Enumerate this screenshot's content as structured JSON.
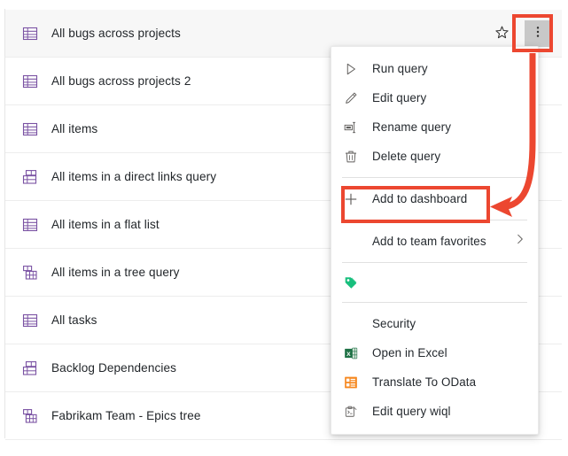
{
  "query_list": {
    "name": "shared-queries-list",
    "rows": [
      {
        "label": "All bugs across projects",
        "icon": "flat-query-icon",
        "selected": true
      },
      {
        "label": "All bugs across projects 2",
        "icon": "flat-query-icon",
        "selected": false
      },
      {
        "label": "All items",
        "icon": "flat-query-icon",
        "selected": false
      },
      {
        "label": "All items in a direct links query",
        "icon": "direct-links-query-icon",
        "selected": false
      },
      {
        "label": "All items in a flat list",
        "icon": "flat-query-icon",
        "selected": false
      },
      {
        "label": "All items in a tree query",
        "icon": "tree-query-icon",
        "selected": false
      },
      {
        "label": "All tasks",
        "icon": "flat-query-icon",
        "selected": false
      },
      {
        "label": "Backlog Dependencies",
        "icon": "direct-links-query-icon",
        "selected": false
      },
      {
        "label": "Fabrikam Team - Epics tree",
        "icon": "tree-query-icon",
        "selected": false
      }
    ],
    "row_actions": {
      "favorite_icon": "star-outline-icon",
      "more_icon": "more-vertical-icon"
    }
  },
  "context_menu": {
    "items": [
      {
        "label": "Run query",
        "icon": "play-icon",
        "type": "item"
      },
      {
        "label": "Edit query",
        "icon": "pencil-icon",
        "type": "item"
      },
      {
        "label": "Rename query",
        "icon": "rename-icon",
        "type": "item"
      },
      {
        "label": "Delete query",
        "icon": "trash-icon",
        "type": "item"
      },
      {
        "type": "separator"
      },
      {
        "label": "Add to dashboard",
        "icon": "plus-icon",
        "type": "item",
        "highlighted": true
      },
      {
        "type": "separator"
      },
      {
        "label": "Add to team favorites",
        "icon": "none",
        "type": "submenu",
        "chevron": "chevron-right-icon"
      },
      {
        "type": "separator"
      },
      {
        "label": "",
        "icon": "tag-icon",
        "type": "item"
      },
      {
        "type": "separator"
      },
      {
        "label": "Security",
        "icon": "none",
        "type": "item"
      },
      {
        "label": "Open in Excel",
        "icon": "excel-icon",
        "type": "item"
      },
      {
        "label": "Translate To OData",
        "icon": "odata-icon",
        "type": "item"
      },
      {
        "label": "Edit query wiql",
        "icon": "wiql-icon",
        "type": "item"
      }
    ]
  },
  "annotations": {
    "highlight_color": "#ec4730",
    "kebab_callout_name": "more-options-highlight",
    "dashboard_callout_name": "add-to-dashboard-highlight",
    "arrow_name": "callout-arrow"
  },
  "colors": {
    "query_icon": "#7a52a3",
    "excel_green": "#1e7145",
    "odata_orange": "#f6881f",
    "tag_green": "#18bf7d",
    "text": "#24292e",
    "row_selected_bg": "#f7f7f7"
  }
}
